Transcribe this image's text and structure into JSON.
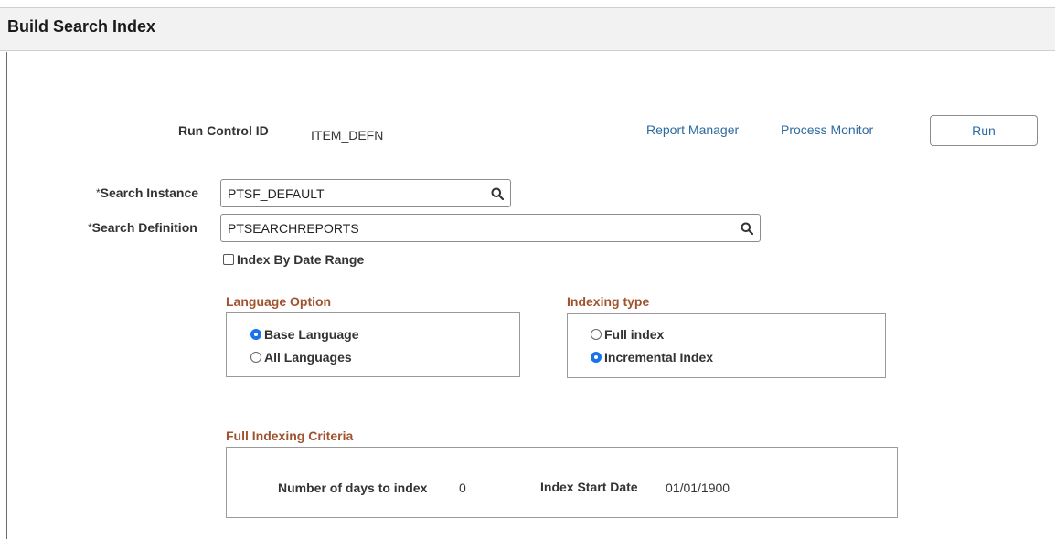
{
  "page": {
    "title": "Build Search Index"
  },
  "run_control": {
    "label": "Run Control ID",
    "value": "ITEM_DEFN"
  },
  "links": {
    "report_manager": "Report Manager",
    "process_monitor": "Process Monitor"
  },
  "run_button": {
    "label": "Run"
  },
  "search_instance": {
    "required_mark": "*",
    "label": "Search Instance",
    "value": "PTSF_DEFAULT"
  },
  "search_definition": {
    "required_mark": "*",
    "label": "Search Definition",
    "value": "PTSEARCHREPORTS"
  },
  "index_by_date_range": {
    "label": "Index By Date Range",
    "checked": false
  },
  "language_option": {
    "title": "Language Option",
    "options": [
      {
        "label": "Base Language",
        "selected": true
      },
      {
        "label": "All Languages",
        "selected": false
      }
    ]
  },
  "indexing_type": {
    "title": "Indexing type",
    "options": [
      {
        "label": "Full index",
        "selected": false
      },
      {
        "label": "Incremental Index",
        "selected": true
      }
    ]
  },
  "full_indexing_criteria": {
    "title": "Full Indexing Criteria",
    "days_label": "Number of days to index",
    "days_value": "0",
    "start_label": "Index Start Date",
    "start_value": "01/01/1900"
  },
  "colors": {
    "accent_link": "#2d6a9f",
    "group_title": "#a0522d",
    "radio_selected": "#1a73e8"
  },
  "icons": {
    "lookup": "search-icon"
  }
}
